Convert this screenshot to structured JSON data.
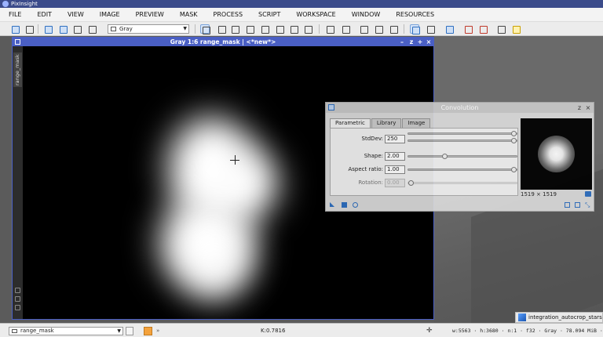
{
  "app": {
    "title": "PixInsight"
  },
  "menu": [
    "FILE",
    "EDIT",
    "VIEW",
    "IMAGE",
    "PREVIEW",
    "MASK",
    "PROCESS",
    "SCRIPT",
    "WORKSPACE",
    "WINDOW",
    "RESOURCES"
  ],
  "toolbar": {
    "channel_select": "Gray"
  },
  "image_window": {
    "title": "Gray 1:6 range_mask | <*new*>",
    "side_tab": "range_mask",
    "controls": [
      "–",
      "z",
      "+",
      "×"
    ]
  },
  "convolution": {
    "title": "Convolution",
    "controls": [
      "z",
      "×"
    ],
    "tabs": [
      "Parametric",
      "Library",
      "Image"
    ],
    "active_tab": "Parametric",
    "params": [
      {
        "label": "StdDev:",
        "value": "250",
        "level": 1.0,
        "disabled": false
      },
      {
        "label": "Shape:",
        "value": "2.00",
        "level": 0.33,
        "disabled": false
      },
      {
        "label": "Aspect ratio:",
        "value": "1.00",
        "level": 1.0,
        "disabled": false
      },
      {
        "label": "Rotation:",
        "value": "0.00",
        "level": 0.0,
        "disabled": true
      }
    ],
    "preview_size": "1519 × 1519"
  },
  "workspace_icon": {
    "label": "integration_autocrop_stars"
  },
  "statusbar": {
    "view_select": "range_mask",
    "more": "»",
    "readout": "K:0.7816",
    "info": "w:5563 · h:3680 · n:1 · f32 · Gray · 78.094 MiB ·"
  },
  "colors": {
    "window_accent": "#4a5fc4",
    "titlebar": "#3b4b8a",
    "mask_color": "#f4a23c"
  }
}
